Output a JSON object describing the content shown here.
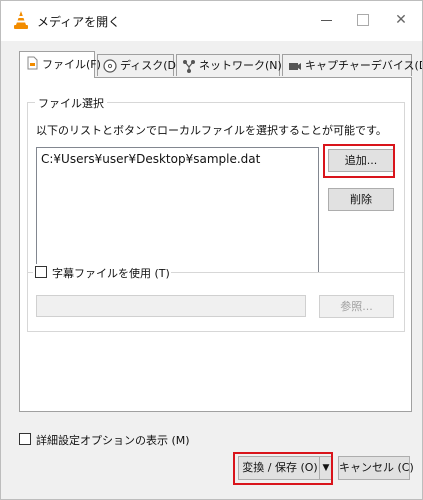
{
  "window": {
    "title": "メディアを開く"
  },
  "tabs": [
    {
      "label": "ファイル(F)",
      "icon": "file-icon",
      "active": true
    },
    {
      "label": "ディスク(D)",
      "icon": "disc-icon",
      "active": false
    },
    {
      "label": "ネットワーク(N)",
      "icon": "network-icon",
      "active": false
    },
    {
      "label": "キャプチャーデバイス(D)",
      "icon": "capture-device-icon",
      "active": false
    }
  ],
  "file_selection": {
    "group_title": "ファイル選択",
    "description": "以下のリストとボタンでローカルファイルを選択することが可能です。",
    "files": [
      "C:¥Users¥user¥Desktop¥sample.dat"
    ],
    "add_button": "追加...",
    "remove_button": "削除"
  },
  "subtitle": {
    "checkbox_label": "字幕ファイルを使用 (T)",
    "checked": false,
    "path_value": "",
    "browse_button": "参照..."
  },
  "footer": {
    "advanced_checkbox_label": "詳細設定オプションの表示 (M)",
    "advanced_checked": false,
    "convert_button": "変換 / 保存 (O)",
    "dropdown_arrow": "▼",
    "cancel_button": "キャンセル (C)"
  },
  "colors": {
    "highlight": "#d9141b",
    "vlc_orange": "#f28c00",
    "dialog_bg": "#f0f0f0"
  }
}
